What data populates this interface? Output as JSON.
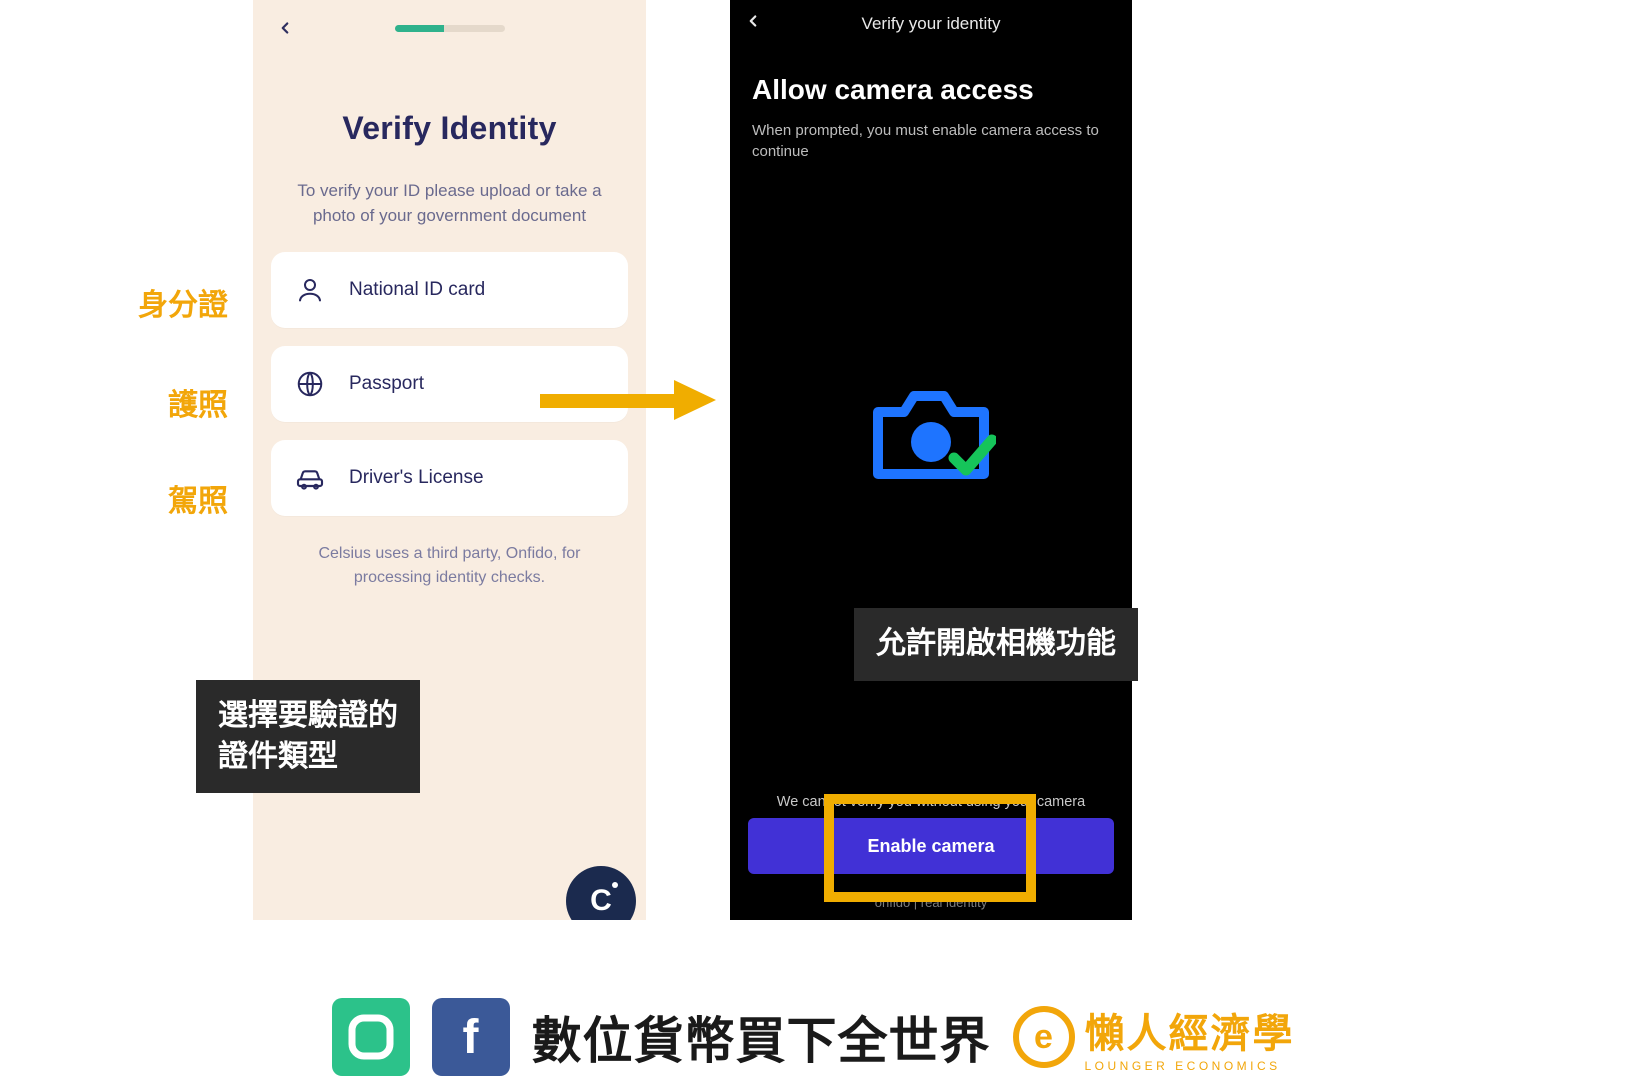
{
  "left": {
    "title": "Verify Identity",
    "subtitle": "To verify your ID please upload or take a photo of your government document",
    "docs": [
      {
        "label": "National ID card"
      },
      {
        "label": "Passport"
      },
      {
        "label": "Driver's License"
      }
    ],
    "disclaimer": "Celsius uses a third party, Onfido, for processing identity checks.",
    "fab_letter": "C"
  },
  "right": {
    "header": "Verify your identity",
    "allow_title": "Allow camera access",
    "allow_sub": "When prompted, you must enable camera access to continue",
    "cannot": "We cannot verify you without using your camera",
    "enable": "Enable camera",
    "footer": "onfido | real identity"
  },
  "labels": {
    "id": "身分證",
    "passport": "護照",
    "license": "駕照"
  },
  "callouts": {
    "left": "選擇要驗證的\n證件類型",
    "right": "允許開啟相機功能"
  },
  "footer": {
    "fb": "f",
    "cn": "數位貨幣買下全世界",
    "lounger_letter": "e",
    "lounger_cn": "懶人經濟學",
    "lounger_en": "LOUNGER ECONOMICS"
  }
}
